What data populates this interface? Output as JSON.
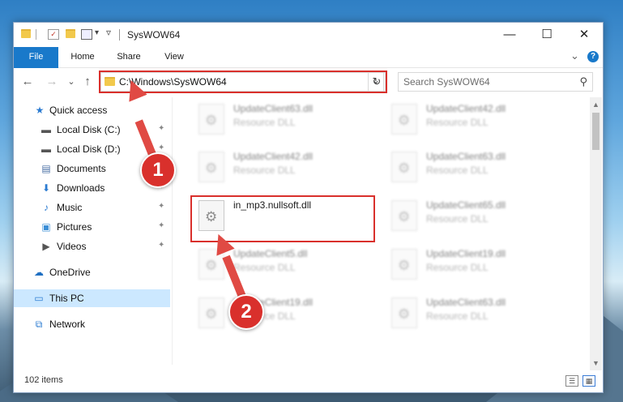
{
  "window": {
    "title": "SysWOW64"
  },
  "window_controls": {
    "minimize": "—",
    "maximize": "☐",
    "close": "✕"
  },
  "ribbon": {
    "tabs": [
      "File",
      "Home",
      "Share",
      "View"
    ],
    "collapse": "⌄",
    "help": "?"
  },
  "nav": {
    "back": "←",
    "forward": "→",
    "recent": "⌄",
    "up": "↑"
  },
  "address": {
    "path": "C:\\Windows\\SysWOW64",
    "dropdown": "⌄",
    "refresh": "↻"
  },
  "search": {
    "placeholder": "Search SysWOW64",
    "icon": "⚲"
  },
  "sidebar": {
    "items": [
      {
        "label": "Quick access",
        "icon": "★"
      },
      {
        "label": "Local Disk (C:)",
        "icon": "▬",
        "pinned": true
      },
      {
        "label": "Local Disk (D:)",
        "icon": "▬",
        "pinned": true
      },
      {
        "label": "Documents",
        "icon": "▤",
        "pinned": true
      },
      {
        "label": "Downloads",
        "icon": "⬇",
        "pinned": true
      },
      {
        "label": "Music",
        "icon": "♪",
        "pinned": true
      },
      {
        "label": "Pictures",
        "icon": "▣",
        "pinned": true
      },
      {
        "label": "Videos",
        "icon": "▶",
        "pinned": true
      },
      {
        "label": "OneDrive",
        "icon": "☁"
      },
      {
        "label": "This PC",
        "icon": "▭",
        "selected": true
      },
      {
        "label": "Network",
        "icon": "⧉"
      }
    ],
    "pin_icon": "📌"
  },
  "files": [
    {
      "name": "UpdateClient63.dll",
      "type": "Resource DLL"
    },
    {
      "name": "UpdateClient42.dll",
      "type": "Resource DLL"
    },
    {
      "name": "UpdateClient42.dll",
      "type": "Resource DLL"
    },
    {
      "name": "UpdateClient63.dll",
      "type": "Resource DLL"
    },
    {
      "name": "in_mp3.nullsoft.dll",
      "type": ""
    },
    {
      "name": "UpdateClient65.dll",
      "type": "Resource DLL"
    },
    {
      "name": "UpdateClient5.dll",
      "type": "Resource DLL"
    },
    {
      "name": "UpdateClient19.dll",
      "type": "Resource DLL"
    },
    {
      "name": "UpdateClient19.dll",
      "type": "Resource DLL"
    },
    {
      "name": "UpdateClient63.dll",
      "type": "Resource DLL"
    }
  ],
  "status": {
    "item_count": "102 items"
  },
  "callouts": [
    "1",
    "2"
  ],
  "colors": {
    "accent": "#1979ca",
    "callout": "#d9302c",
    "selection": "#cce8ff"
  }
}
